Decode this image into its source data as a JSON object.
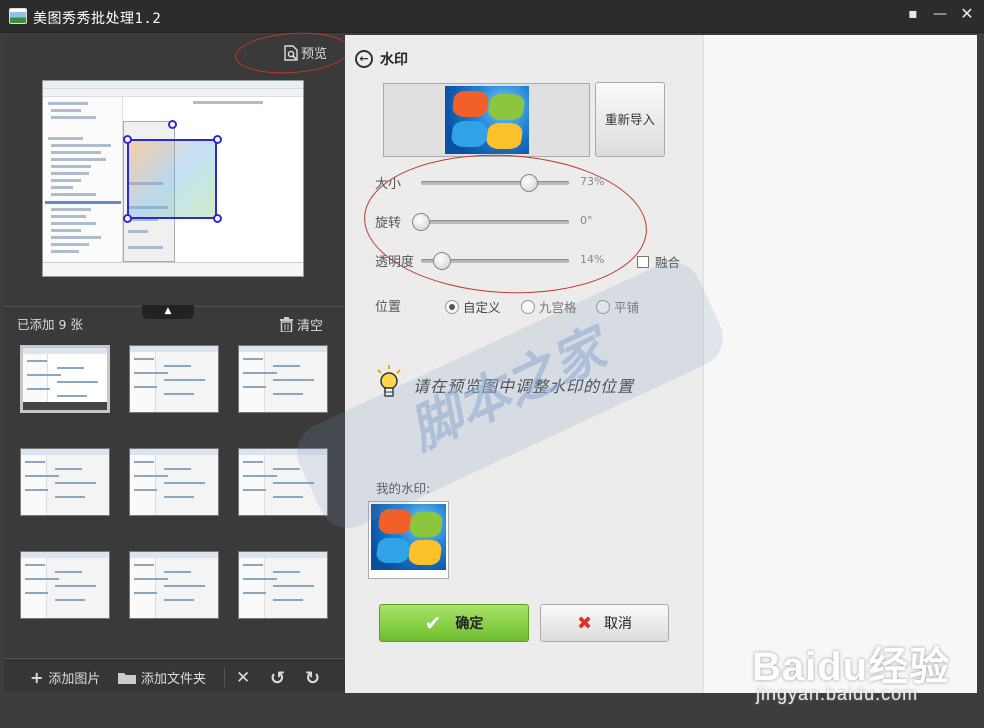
{
  "window": {
    "title": "美图秀秀批处理1.2",
    "icons": {
      "chat": "chat-icon",
      "minimize": "minimize-icon",
      "close": "close-icon"
    }
  },
  "left_panel": {
    "preview_label": "预览",
    "added_count": "已添加 9 张",
    "clear_label": "清空",
    "thumbnail_count": 9,
    "toolbar": {
      "add_image": "添加图片",
      "add_folder": "添加文件夹"
    }
  },
  "watermark_panel": {
    "title": "水印",
    "reimport_label": "重新导入",
    "size": {
      "label": "大小",
      "value": "73%",
      "level": 0.73
    },
    "rotation": {
      "label": "旋转",
      "value": "0°",
      "level": 0.0
    },
    "opacity": {
      "label": "透明度",
      "value": "14%",
      "level": 0.14
    },
    "blend_label": "融合",
    "blend_checked": false,
    "position_label": "位置",
    "position_options": [
      "自定义",
      "九宫格",
      "平铺"
    ],
    "position_selected": "自定义",
    "hint_text": "请在预览图中调整水印的位置",
    "my_watermark_label": "我的水印:",
    "ok_label": "确定",
    "cancel_label": "取消"
  },
  "overlay": {
    "background_watermark": "脚本之家",
    "baidu_logo": "Baidu经验",
    "baidu_url": "jingyan.baidu.com"
  },
  "colors": {
    "ok_button": "#7ccb3a",
    "annotation": "#c0392b",
    "selection": "#2a2acf"
  }
}
